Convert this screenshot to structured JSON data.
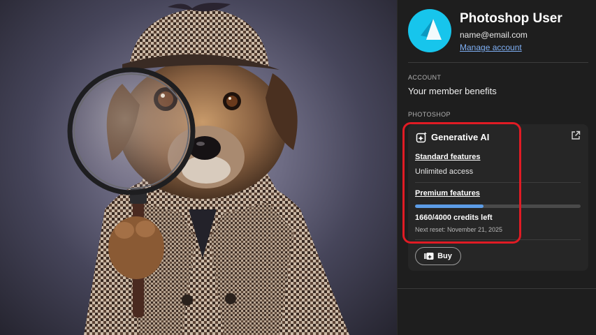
{
  "photo": {
    "subject": "dog-detective-photo"
  },
  "account": {
    "name": "Photoshop User",
    "email": "name@email.com",
    "manage_link": "Manage account",
    "section_label": "ACCOUNT",
    "benefits": "Your member benefits"
  },
  "photoshop": {
    "section_label": "PHOTOSHOP",
    "card": {
      "title": "Generative AI",
      "standard_label": "Standard features",
      "standard_value": "Unlimited access",
      "premium_label": "Premium features",
      "credits_used_fraction": 0.415,
      "credits_text": "1660/4000 credits left",
      "next_reset": "Next reset: November 21, 2025",
      "buy_label": "Buy"
    }
  },
  "colors": {
    "accent_link": "#7fb0f5",
    "avatar": "#17c5ec",
    "progress": "#5c9ce6",
    "highlight": "#e01b24"
  }
}
